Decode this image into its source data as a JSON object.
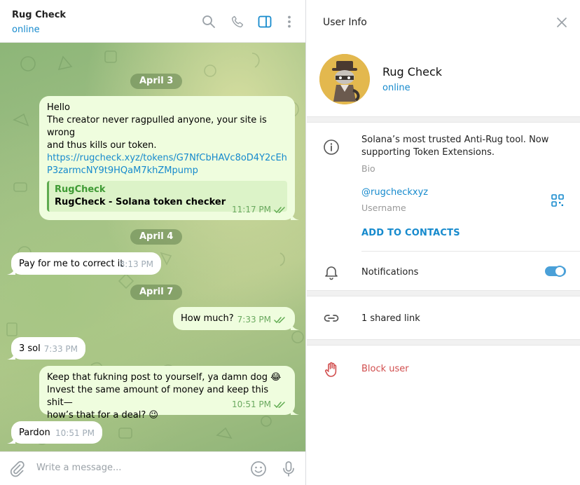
{
  "chat": {
    "title": "Rug Check",
    "status": "online",
    "header_icons": [
      "search-icon",
      "phone-icon",
      "sidebar-toggle-icon",
      "more-vertical-icon"
    ],
    "dates": [
      "April 3",
      "April 4",
      "April 7"
    ],
    "messages": [
      {
        "direction": "out",
        "lines": [
          "Hello",
          "The creator never ragpulled anyone, your site is wrong",
          "and thus kills our token."
        ],
        "link": "https://rugcheck.xyz/tokens/G7NfCbHAVc8oD4Y2cEhP3zarmcNY9t9HQaM7khZMpump",
        "preview_site": "RugCheck",
        "preview_title": "RugCheck - Solana token checker",
        "time": "11:17 PM"
      },
      {
        "direction": "in",
        "text": "Pay for me to correct it",
        "time": "8:13 PM"
      },
      {
        "direction": "out",
        "text": "How much?",
        "time": "7:33 PM"
      },
      {
        "direction": "in",
        "text": "3 sol",
        "time": "7:33 PM"
      },
      {
        "direction": "out",
        "lines": [
          "Keep that fukning post to yourself, ya damn dog 😂",
          "Invest the same amount of money and keep this shit—",
          "how’s that for a deal? 😉"
        ],
        "time": "10:51 PM"
      },
      {
        "direction": "in",
        "text": "Pardon",
        "time": "10:51 PM"
      }
    ],
    "composer_placeholder": "Write a message..."
  },
  "info": {
    "title": "User Info",
    "name": "Rug Check",
    "status": "online",
    "bio": [
      "Solana’s most trusted Anti-Rug tool. Now",
      "supporting Token Extensions."
    ],
    "bio_label": "Bio",
    "username": "@rugcheckxyz",
    "username_label": "Username",
    "add_contacts": "ADD TO CONTACTS",
    "notifications": "Notifications",
    "notifications_on": true,
    "shared_links": "1 shared link",
    "block_user": "Block user"
  },
  "colors": {
    "accent": "#168acd",
    "outgoing_bubble": "#effdde",
    "time_out": "#6aa95f",
    "danger": "#d14e4e"
  }
}
